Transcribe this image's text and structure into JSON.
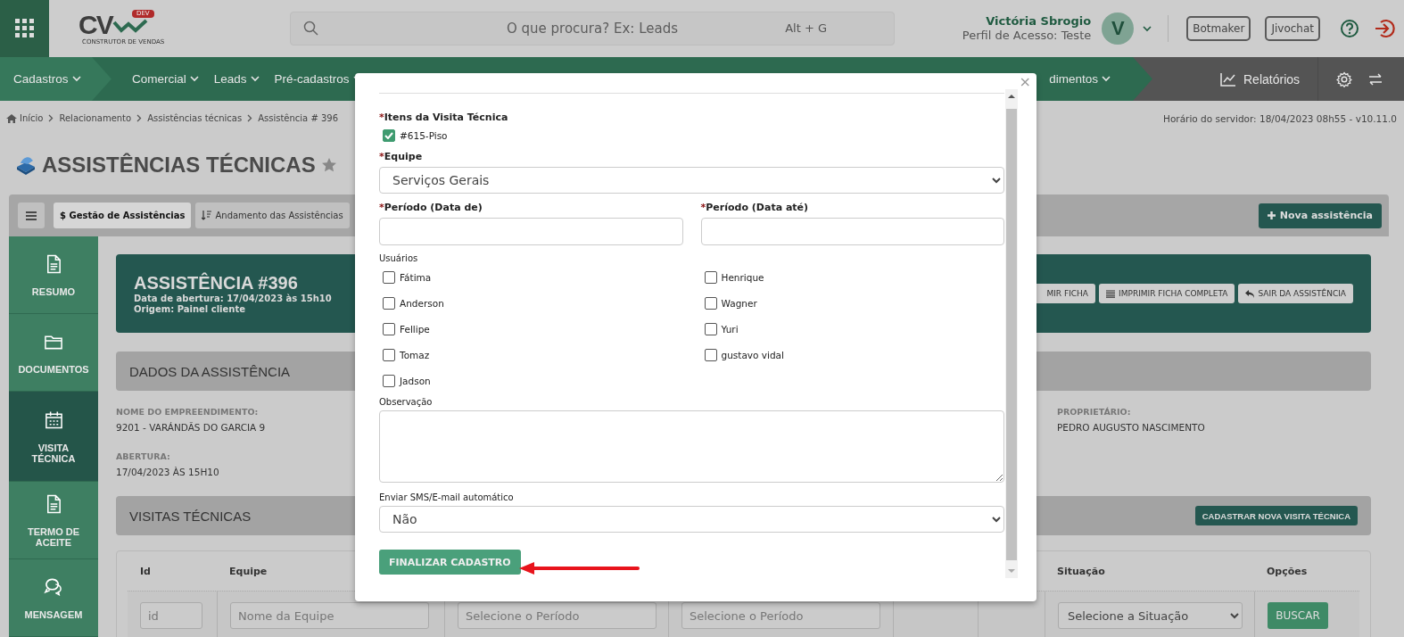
{
  "header": {
    "logo": {
      "letters": "CV",
      "badge": "DEV",
      "tagline": "CONSTRUTOR DE VENDAS"
    },
    "search": {
      "placeholder": "O que procura? Ex: Leads",
      "shortcut": "Alt + G"
    },
    "user": {
      "name": "Victória Sbrogio",
      "profile": "Perfil de Acesso: Teste",
      "avatar": "V"
    },
    "buttons": [
      "Botmaker",
      "Jivochat"
    ]
  },
  "nav": {
    "items": [
      "Cadastros",
      "Comercial",
      "Leads",
      "Pré-cadastros"
    ],
    "partial_item": "dimentos",
    "reports": "Relatórios"
  },
  "breadcrumb": [
    "Início",
    "Relacionamento",
    "Assistências técnicas",
    "Assistência # 396"
  ],
  "server_time": "Horário do servidor: 18/04/2023 08h55 - v10.11.0",
  "page_title": "ASSISTÊNCIAS TÉCNICAS",
  "toolbar": {
    "tabs": [
      {
        "label": "$ Gestão de Assistências",
        "selected": true
      },
      {
        "label": "Andamento das Assistências",
        "selected": false
      }
    ],
    "new_button": "Nova assistência"
  },
  "sidenav": [
    {
      "label": "RESUMO",
      "selected": false
    },
    {
      "label": "DOCUMENTOS",
      "selected": false
    },
    {
      "label": "VISITA TÉCNICA",
      "selected": true
    },
    {
      "label": "TERMO DE ACEITE",
      "selected": false
    },
    {
      "label": "MENSAGEM",
      "selected": false
    }
  ],
  "assistance": {
    "title": "ASSISTÊNCIA #396",
    "opened": "Data de abertura: 17/04/2023 às 15h10",
    "origin": "Origem: Painel cliente",
    "actions": [
      "MIR FICHA",
      "IMPRIMIR FICHA COMPLETA",
      "SAIR DA ASSISTÊNCIA"
    ]
  },
  "details": {
    "title": "DADOS DA ASSISTÊNCIA",
    "fields": [
      {
        "label": "NOME DO EMPREENDIMENTO:",
        "value": "9201 - VARÁNDÃS DO GARCIA 9"
      },
      {
        "label": "PROPRIETÁRIO:",
        "value": "PEDRO AUGUSTO NASCIMENTO"
      },
      {
        "label": "ABERTURA:",
        "value": "17/04/2023 ÀS 15H10"
      }
    ]
  },
  "visits": {
    "title": "VISITAS TÉCNICAS",
    "button": "CADASTRAR NOVA VISITA TÉCNICA",
    "table": {
      "columns": [
        "Id",
        "Equipe",
        "",
        "",
        "",
        "",
        "Situação",
        "Opções"
      ],
      "filters": [
        {
          "kind": "input",
          "placeholder": "id"
        },
        {
          "kind": "input",
          "placeholder": "Nome da Equipe"
        },
        {
          "kind": "input",
          "placeholder": "Selecione o Período"
        },
        {
          "kind": "input",
          "placeholder": "Selecione o Período"
        },
        {
          "kind": "empty"
        },
        {
          "kind": "empty"
        },
        {
          "kind": "select",
          "value": "Selecione a Situação"
        },
        {
          "kind": "button",
          "label": "BUSCAR"
        }
      ]
    }
  },
  "modal": {
    "close": "×",
    "items_label": {
      "mark": "*",
      "text": "Itens da Visita Técnica"
    },
    "items": [
      {
        "label": "#615-Piso",
        "checked": true
      }
    ],
    "team_label": {
      "mark": "*",
      "text": "Equipe"
    },
    "team": "Serviços Gerais",
    "period_labels": [
      {
        "mark": "*",
        "text": "Período (Data de)"
      },
      {
        "mark": "*",
        "text": "Período (Data até)"
      }
    ],
    "users_label": "Usuários",
    "users": [
      {
        "name": "Fátima",
        "checked": false
      },
      {
        "name": "Henrique",
        "checked": false
      },
      {
        "name": "Anderson",
        "checked": false
      },
      {
        "name": "Wagner",
        "checked": false
      },
      {
        "name": "Fellipe",
        "checked": false
      },
      {
        "name": "Yuri",
        "checked": false
      },
      {
        "name": "Tomaz",
        "checked": false
      },
      {
        "name": "gustavo vidal",
        "checked": false
      },
      {
        "name": "Jadson",
        "checked": false
      }
    ],
    "note_label": "Observação",
    "sms_label": "Enviar SMS/E-mail automático",
    "sms": "Não",
    "submit": "FINALIZAR CADASTRO"
  }
}
